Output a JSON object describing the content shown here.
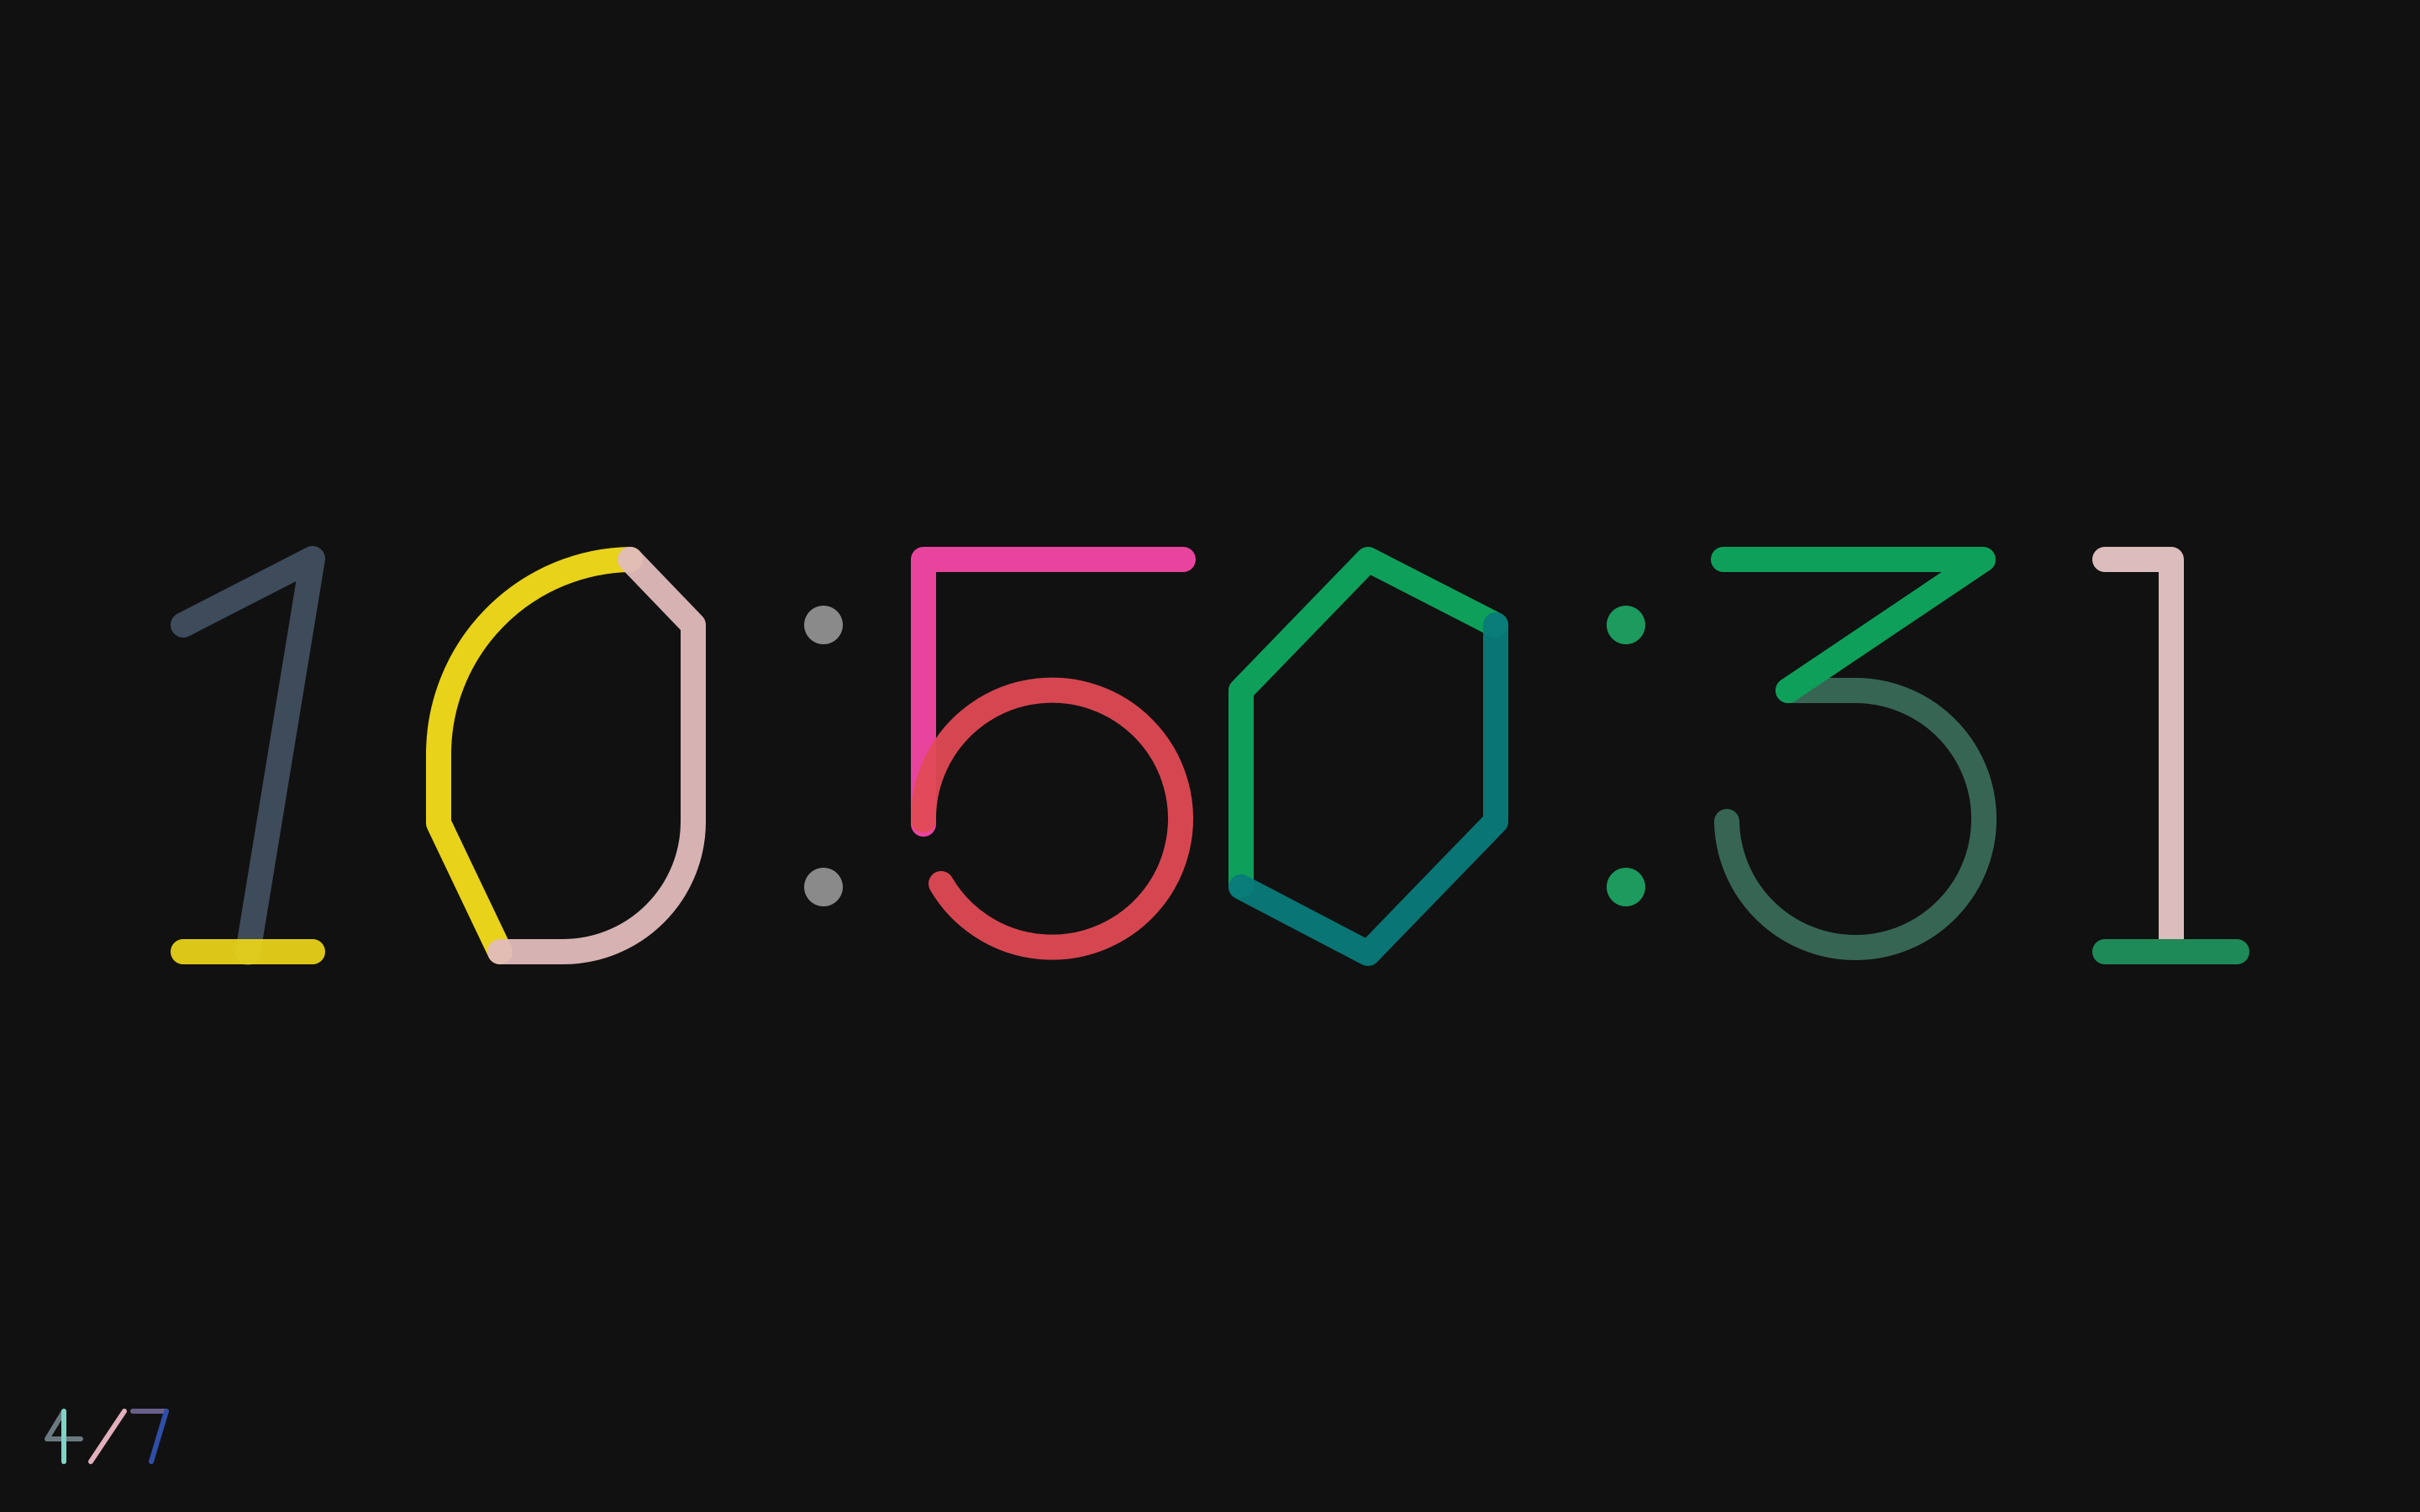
{
  "clock": {
    "time_text": "10:50:31",
    "hours": "10",
    "minutes": "50",
    "seconds": "31",
    "separator": ":",
    "colors": {
      "background": "#111111",
      "digit_1_diagonal": "#3e4b5a",
      "digit_1_base": "#e8d21a",
      "digit_0_left_arc": "#e8d21a",
      "digit_0_right": "#e2bcbc",
      "colon_1": "#8a8a8a",
      "digit_5_top": "#e8449e",
      "digit_5_bowl": "#e24a55",
      "digit_0b_left": "#0ea05a",
      "digit_0b_right": "#0a7b7a",
      "colon_2": "#1d9a5e",
      "digit_3_top": "#0ea05a",
      "digit_3_bowl": "#3a6a58",
      "digit_1b_stem": "#dcbcbc",
      "digit_1b_base": "#1d8a58"
    }
  },
  "pager": {
    "current": "4",
    "total": "7",
    "separator": "/",
    "colors": {
      "four_left": "#6a7a80",
      "four_stem": "#7fd4c8",
      "slash": "#e2b0bc",
      "seven_top": "#6a5f8a",
      "seven_stem": "#2f4ea8"
    }
  }
}
